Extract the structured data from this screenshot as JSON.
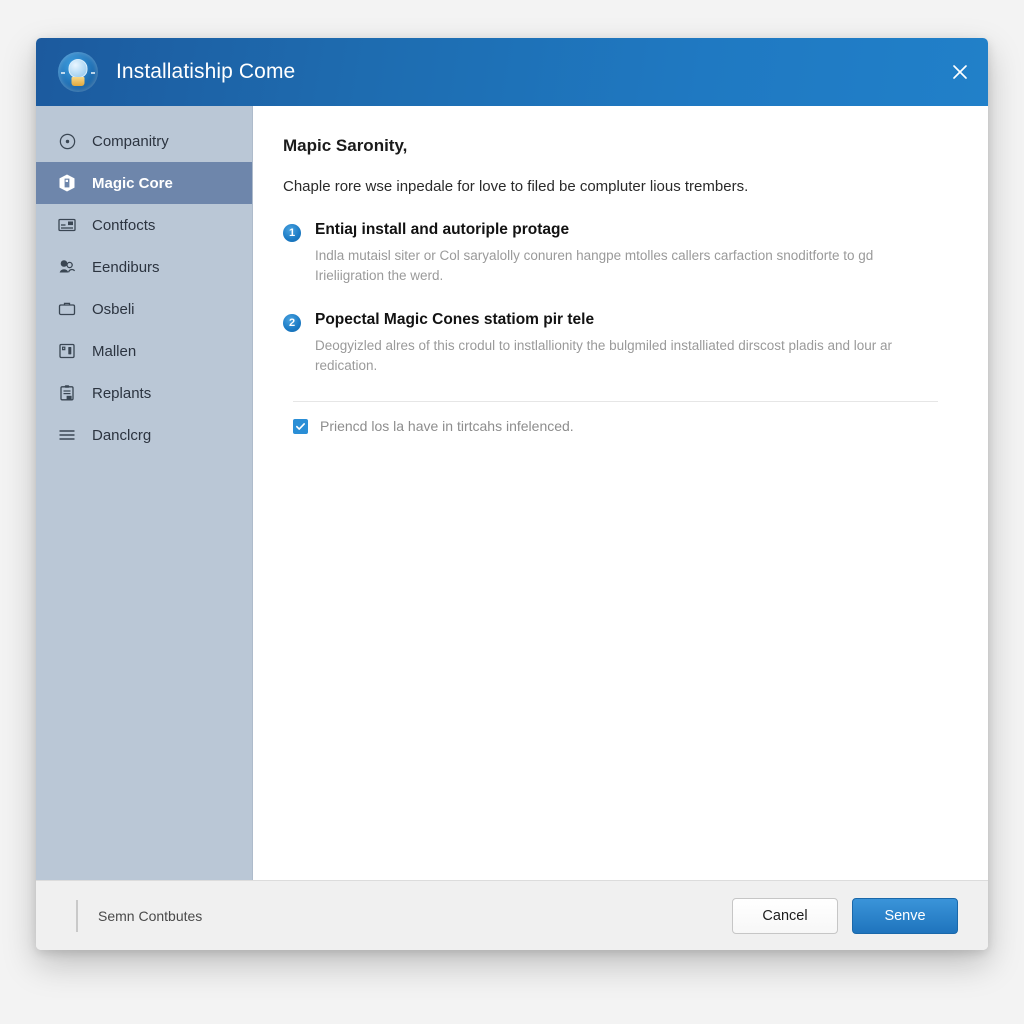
{
  "window": {
    "title": "Installatiship Come",
    "app_icon": "lightbulb-balloon-icon",
    "close_icon": "close-icon"
  },
  "sidebar": {
    "items": [
      {
        "label": "Companitry",
        "icon": "target-circle-icon",
        "selected": false
      },
      {
        "label": "Magic Core",
        "icon": "cube-box-icon",
        "selected": true
      },
      {
        "label": "Contfocts",
        "icon": "contact-card-icon",
        "selected": false
      },
      {
        "label": "Eendiburs",
        "icon": "people-group-icon",
        "selected": false
      },
      {
        "label": "Osbeli",
        "icon": "briefcase-icon",
        "selected": false
      },
      {
        "label": "Mallen",
        "icon": "id-badge-icon",
        "selected": false
      },
      {
        "label": "Replants",
        "icon": "clipboard-icon",
        "selected": false
      },
      {
        "label": "Danclcrg",
        "icon": "hamburger-menu-icon",
        "selected": false
      }
    ]
  },
  "content": {
    "heading": "Mapic Saronity,",
    "intro": "Chaple rore wse inpedale for love to filed be compluter lious trembers.",
    "steps": [
      {
        "number": "1",
        "title": "Entiaȷ install and autoriple protage",
        "description": "Indla mutaisl siter or Col saryalolly conuren hangpe mtolles callers carfaction snoditforte to gd Irieliigration the werd."
      },
      {
        "number": "2",
        "title": "Popectal Magic Cones statiom pir tele",
        "description": "Deogyizled alres of this crodul to instlallionity the bulgmiled installiated dirscost pladis and lour ar redication."
      }
    ],
    "checkbox": {
      "label": "Priencd los la have in tirtcahs infelenced.",
      "checked": true
    }
  },
  "footer": {
    "status_text": "Semn Contbutes",
    "cancel_label": "Cancel",
    "primary_label": "Senve"
  },
  "colors": {
    "titlebar_start": "#1c5a9e",
    "titlebar_end": "#2180c9",
    "sidebar_bg": "#bac7d6",
    "sidebar_selected": "#6e86ab",
    "accent_blue": "#1f74bd",
    "checkbox_blue": "#2a8ed6",
    "footer_bg": "#f0f0f0"
  }
}
